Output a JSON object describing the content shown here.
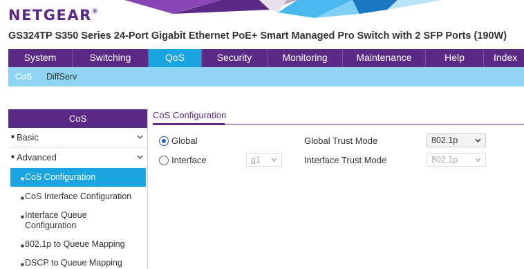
{
  "brand": {
    "logo": "NETGEAR",
    "logo_mark": "®"
  },
  "product_title": "GS324TP S350 Series 24-Port Gigabit Ethernet PoE+ Smart Managed Pro Switch with 2 SFP Ports (190W)",
  "colors": {
    "brand_purple": "#5b2a86",
    "active_blue": "#1ba5e0",
    "subnav_blue": "#8fd4f2"
  },
  "main_nav": {
    "tabs": [
      {
        "label": "System"
      },
      {
        "label": "Switching"
      },
      {
        "label": "QoS",
        "active": true
      },
      {
        "label": "Security"
      },
      {
        "label": "Monitoring"
      },
      {
        "label": "Maintenance"
      },
      {
        "label": "Help"
      },
      {
        "label": "Index"
      }
    ]
  },
  "sub_nav": {
    "items": [
      {
        "label": "CoS",
        "active": true
      },
      {
        "label": "DiffServ"
      }
    ]
  },
  "sidebar": {
    "title": "CoS",
    "items": [
      {
        "label": "Basic",
        "icon": "chevron-down-icon"
      },
      {
        "label": "Advanced",
        "icon": "chevron-down-icon"
      },
      {
        "label": "CoS Configuration",
        "active": true
      },
      {
        "label": "CoS Interface Configuration"
      },
      {
        "label": "Interface Queue Configuration"
      },
      {
        "label": "802.1p to Queue Mapping"
      },
      {
        "label": "DSCP to Queue Mapping"
      }
    ]
  },
  "main": {
    "section_title": "CoS Configuration",
    "global": {
      "label": "Global",
      "selected": true,
      "trust_mode_label": "Global Trust Mode",
      "trust_mode_value": "802.1p"
    },
    "interface": {
      "label": "Interface",
      "selected": false,
      "port_value": "g1",
      "trust_mode_label": "Interface Trust Mode",
      "trust_mode_value": "802.1p"
    }
  }
}
